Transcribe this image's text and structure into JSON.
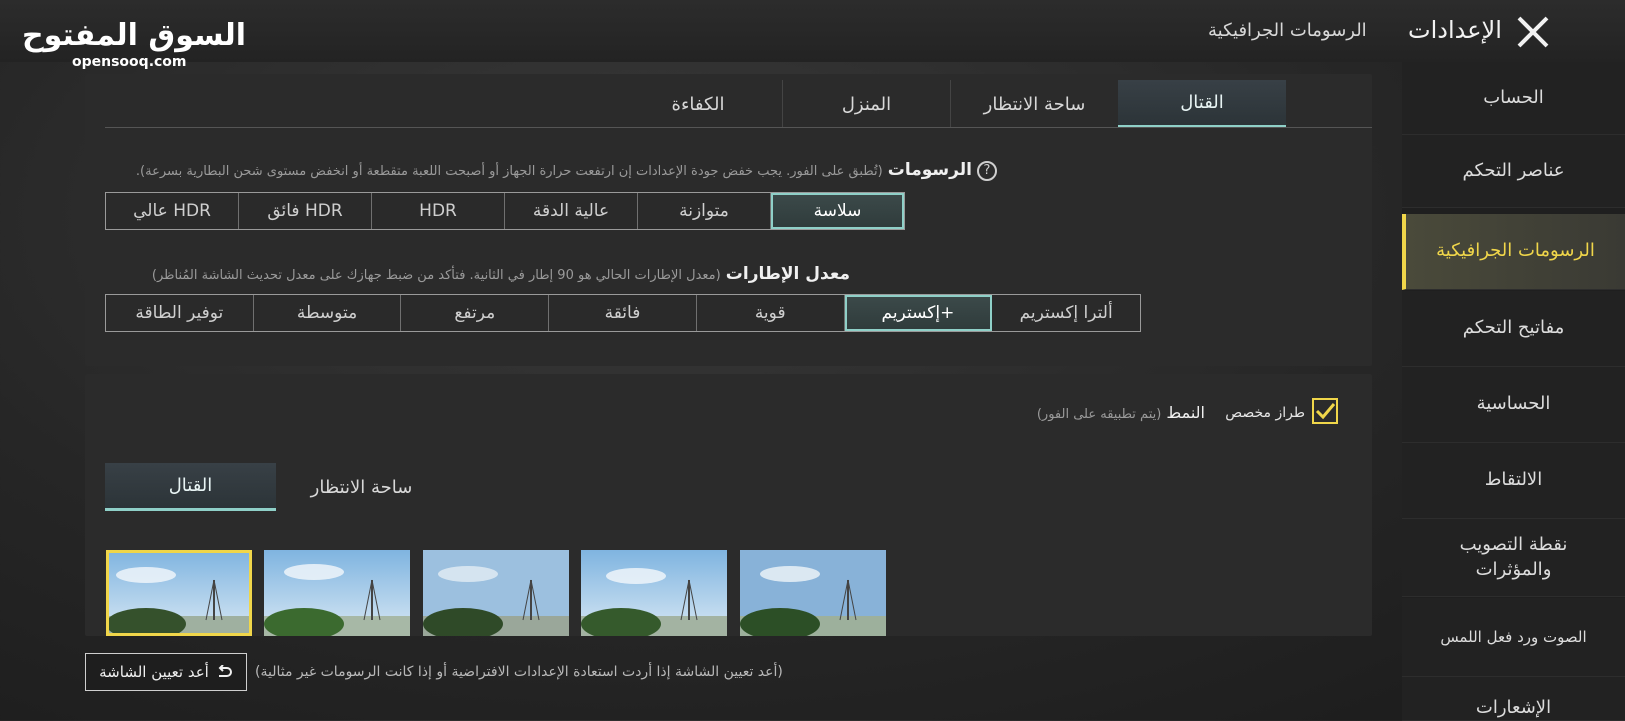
{
  "brand": {
    "logo_ar": "السوق المفتوح",
    "logo_en": "opensooq.com"
  },
  "header": {
    "title": "الإعدادات",
    "breadcrumb": "الرسومات الجرافيكية"
  },
  "sidebar": {
    "items": [
      {
        "label": "الحساب"
      },
      {
        "label": "عناصر التحكم"
      },
      {
        "label": "الرسومات الجرافيكية"
      },
      {
        "label": "مفاتيح التحكم"
      },
      {
        "label": "الحساسية"
      },
      {
        "label": "الالتقاط"
      },
      {
        "label": "نقطة التصويب والمؤثرات"
      },
      {
        "label": "الصوت ورد فعل اللمس"
      },
      {
        "label": "الإشعارات"
      }
    ]
  },
  "top_tabs": [
    "القتال",
    "ساحة الانتظار",
    "المنزل",
    "الكفاءة"
  ],
  "graphics": {
    "label": "الرسومات",
    "note": "(تُطبق على الفور. يجب خفض جودة الإعدادات إن ارتفعت حرارة الجهاز أو أصبحت اللعبة متقطعة أو انخفض مستوى شحن البطارية بسرعة).",
    "options": [
      "سلاسة",
      "متوازنة",
      "عالية الدقة",
      "HDR",
      "فائق HDR",
      "عالي HDR"
    ],
    "selected": "سلاسة"
  },
  "framerate": {
    "label": "معدل الإطارات",
    "note": "(معدل الإطارات الحالي هو 90 إطار في الثانية. فتأكد من ضبط جهازك على معدل تحديث الشاشة المُناظر)",
    "options": [
      "توفير الطاقة",
      "متوسطة",
      "مرتفع",
      "فائقة",
      "قوية",
      "إكستريم+",
      "ألترا إكستريم"
    ],
    "selected": "إكستريم+"
  },
  "style": {
    "custom_label": "طراز مخصص",
    "custom_checked": true,
    "label": "النمط",
    "note": "(يتم تطبيقه على الفور)",
    "tabs": [
      "القتال",
      "ساحة الانتظار"
    ],
    "thumbnails": 5,
    "selected_index": 0
  },
  "footer": {
    "reset_label": "أعد تعيين الشاشة",
    "reset_note": "(أعد تعيين الشاشة إذا أردت استعادة الإعدادات الافتراضية أو إذا كانت الرسومات غير مثالية)"
  },
  "colors": {
    "accent_yellow": "#f0d64a",
    "accent_teal": "#8fd0c8"
  }
}
